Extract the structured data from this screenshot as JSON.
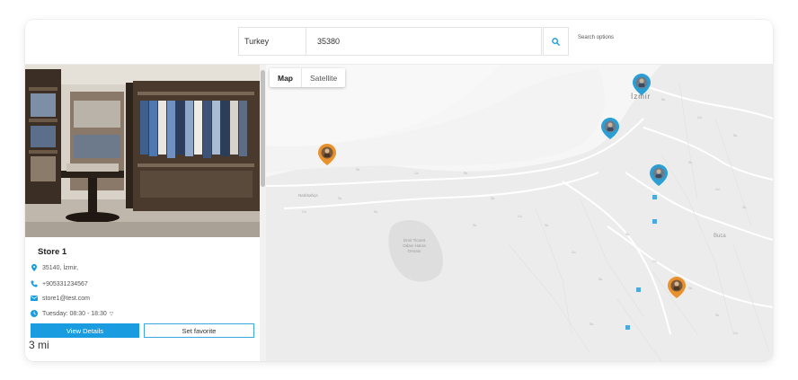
{
  "search": {
    "country": "Turkey",
    "postal_code": "35380",
    "options_label": "Search options"
  },
  "store": {
    "name": "Store 1",
    "address": "35140, İzmir,",
    "phone": "+905331234567",
    "email": "store1@test.com",
    "hours": "Tuesday: 08:30 - 18:30",
    "view_details_label": "View Details",
    "favorite_label": "Set favorite",
    "distance": "3 mi"
  },
  "map": {
    "tab_map": "Map",
    "tab_satellite": "Satellite",
    "city_label": "İzmir",
    "places": {
      "narlidere": "Narlıbahçe",
      "buca": "Buca",
      "chamber": "İzmir Ticaret Odası Hatıra Ormanı"
    },
    "markers": [
      {
        "color": "#2a9fd6",
        "label": "store-marker-izmir"
      },
      {
        "color": "#2a9fd6",
        "label": "store-marker-alsancak"
      },
      {
        "color": "#2a9fd6",
        "label": "store-marker-konak"
      },
      {
        "color": "#e8912d",
        "label": "store-marker-guzelbahce"
      },
      {
        "color": "#e8912d",
        "label": "store-marker-karabaglar"
      }
    ]
  },
  "colors": {
    "accent": "#1a9de0",
    "marker_blue": "#2a9fd6",
    "marker_orange": "#e8912d"
  }
}
